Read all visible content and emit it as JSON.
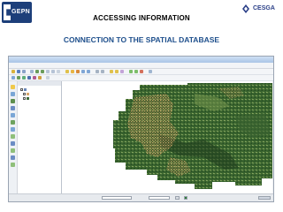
{
  "slide": {
    "logo_left_text": "GEPN",
    "logo_right_text": "CESGA",
    "title": "ACCESSING INFORMATION",
    "subtitle": "CONNECTION TO THE SPATIAL DATABASE"
  },
  "app": {
    "colors": {
      "window_bg": "#eef0f3",
      "titlebar": "#a9c4e6",
      "map_vegetation_dark": "#2f5a2a",
      "map_vegetation_light": "#5f8a44",
      "map_polygons": "#d7a56a"
    },
    "menu": [],
    "layers_panel": {
      "rows": [
        {
          "icon": "layer-group-icon"
        },
        {
          "icon": "vector-polygon-icon"
        },
        {
          "icon": "raster-icon"
        }
      ]
    },
    "toolbar_icons": [
      "open-project-icon",
      "save-project-icon",
      "pan-icon",
      "zoom-in-icon",
      "zoom-out-icon",
      "identify-icon",
      "select-icon",
      "measure-icon",
      "add-vector-icon",
      "add-raster-icon",
      "add-database-layer-icon"
    ],
    "side_tools": [
      "digitize-icon",
      "node-tool-icon",
      "move-feature-icon",
      "delete-icon",
      "split-icon",
      "merge-icon",
      "reshape-icon",
      "rotate-icon",
      "offset-icon",
      "simplify-icon",
      "fill-ring-icon",
      "add-part-icon"
    ]
  }
}
